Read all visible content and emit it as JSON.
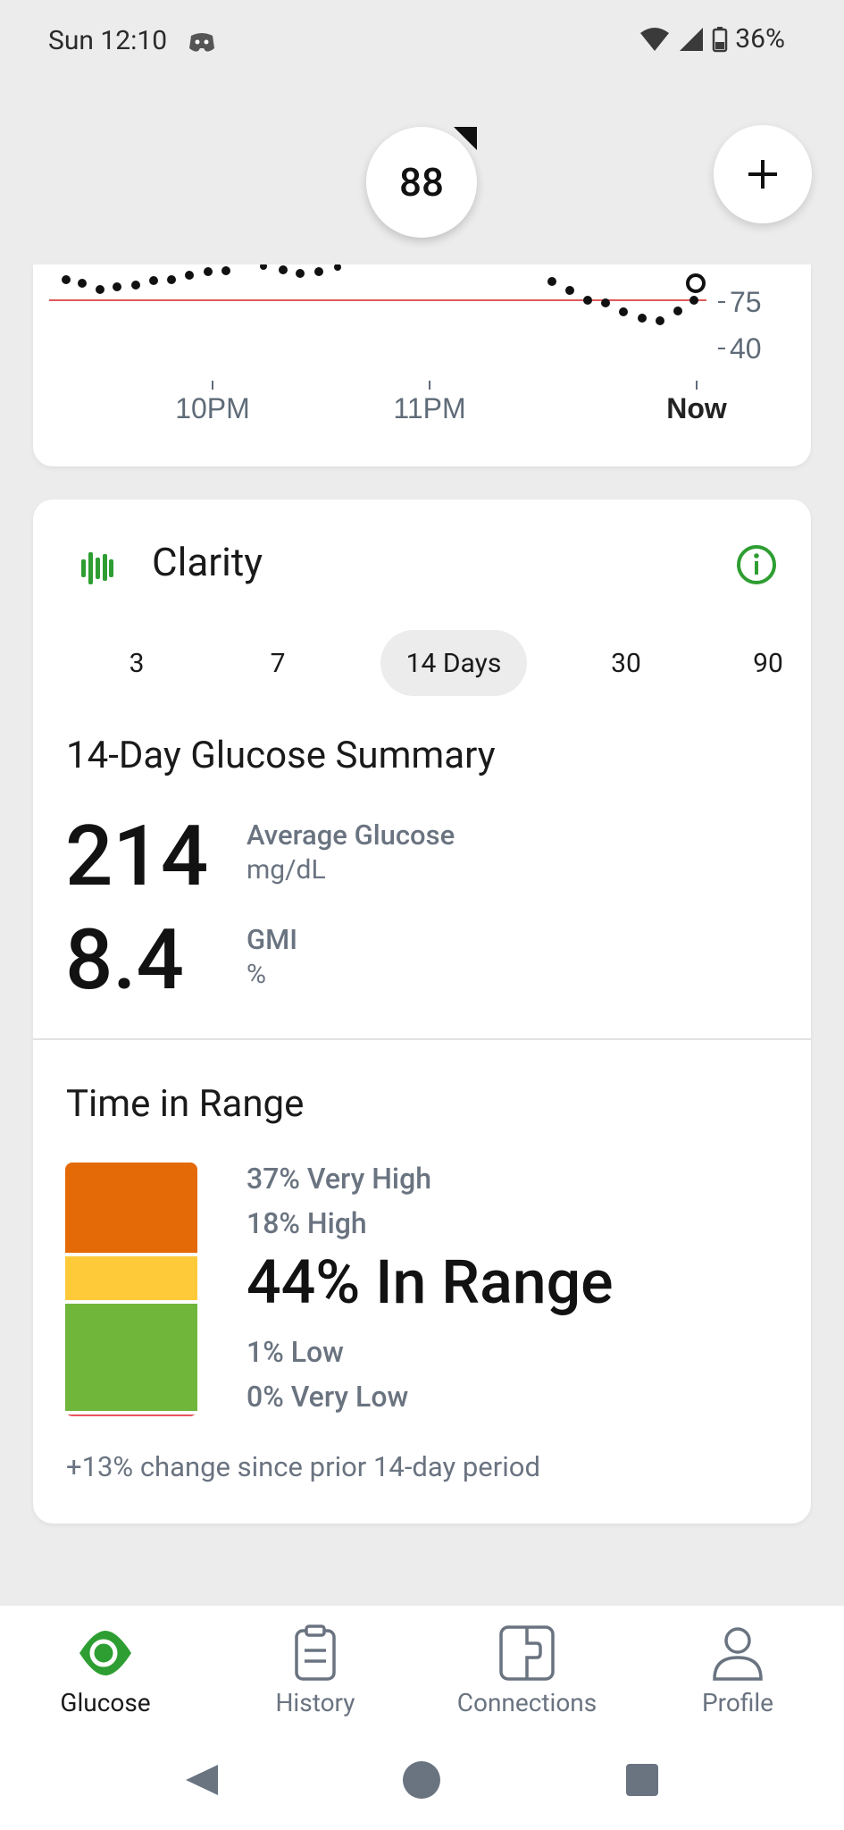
{
  "status_bar": {
    "time": "Sun 12:10",
    "battery": "36%"
  },
  "reading": {
    "value": "88"
  },
  "chart": {
    "y_ticks": [
      "75",
      "40"
    ],
    "x_ticks": [
      "10PM",
      "11PM",
      "Now"
    ]
  },
  "clarity": {
    "title": "Clarity",
    "periods": [
      "3",
      "7",
      "14 Days",
      "30",
      "90"
    ],
    "active_period": "14 Days",
    "summary_title": "14-Day Glucose Summary",
    "avg_glucose": {
      "value": "214",
      "label": "Average Glucose",
      "unit": "mg/dL"
    },
    "gmi": {
      "value": "8.4",
      "label": "GMI",
      "unit": "%"
    },
    "tir_title": "Time in Range",
    "tir": {
      "very_high": "37% Very High",
      "high": "18% High",
      "in_range": "44% In Range",
      "low": "1% Low",
      "very_low": "0% Very Low"
    },
    "tir_fractions": {
      "very_high": 0.37,
      "high": 0.18,
      "in_range": 0.44,
      "low": 0.01,
      "very_low": 0.0
    },
    "change_text": "+13% change since prior 14-day period"
  },
  "nav": {
    "glucose": "Glucose",
    "history": "History",
    "connections": "Connections",
    "profile": "Profile"
  },
  "colors": {
    "accent_green": "#2e9e32",
    "very_high": "#e36a07",
    "high": "#ffca3a",
    "in_range": "#6fb63a",
    "low": "#e8545a",
    "low_line": "#e05a5a"
  }
}
